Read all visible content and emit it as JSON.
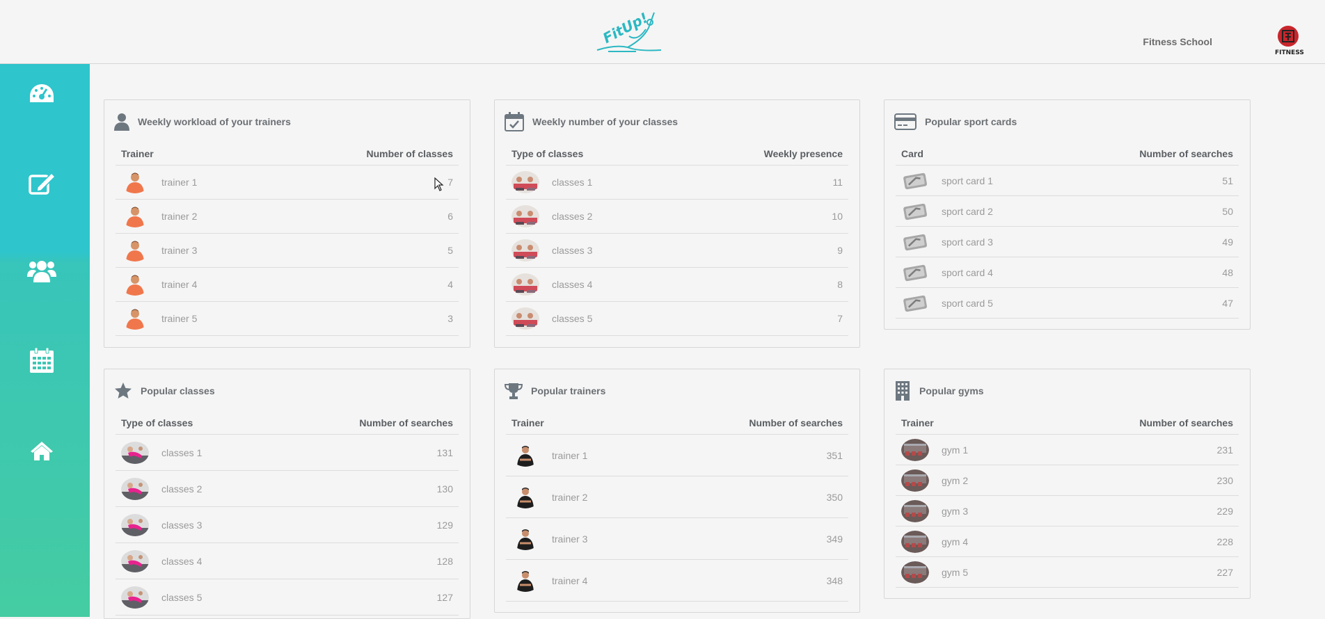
{
  "header": {
    "logo_text": "FitUp!",
    "school_name": "Fitness School",
    "school_logo_text": "FITNESS"
  },
  "sidebar": {
    "items": [
      {
        "icon": "dashboard-icon"
      },
      {
        "icon": "edit-icon"
      },
      {
        "icon": "users-icon"
      },
      {
        "icon": "calendar-icon"
      },
      {
        "icon": "home-icon"
      }
    ]
  },
  "panels": {
    "workload": {
      "title": "Weekly workload of your trainers",
      "col1": "Trainer",
      "col2": "Number of classes",
      "rows": [
        {
          "name": "trainer 1",
          "value": "7"
        },
        {
          "name": "trainer 2",
          "value": "6"
        },
        {
          "name": "trainer 3",
          "value": "5"
        },
        {
          "name": "trainer 4",
          "value": "4"
        },
        {
          "name": "trainer 5",
          "value": "3"
        }
      ]
    },
    "classes_weekly": {
      "title": "Weekly number of your classes",
      "col1": "Type of classes",
      "col2": "Weekly presence",
      "rows": [
        {
          "name": "classes 1",
          "value": "11"
        },
        {
          "name": "classes 2",
          "value": "10"
        },
        {
          "name": "classes 3",
          "value": "9"
        },
        {
          "name": "classes 4",
          "value": "8"
        },
        {
          "name": "classes 5",
          "value": "7"
        }
      ]
    },
    "sport_cards": {
      "title": "Popular sport cards",
      "col1": "Card",
      "col2": "Number of searches",
      "rows": [
        {
          "name": "sport card 1",
          "value": "51"
        },
        {
          "name": "sport card 2",
          "value": "50"
        },
        {
          "name": "sport card 3",
          "value": "49"
        },
        {
          "name": "sport card 4",
          "value": "48"
        },
        {
          "name": "sport card 5",
          "value": "47"
        }
      ]
    },
    "popular_classes": {
      "title": "Popular classes",
      "col1": "Type of classes",
      "col2": "Number of searches",
      "rows": [
        {
          "name": "classes 1",
          "value": "131"
        },
        {
          "name": "classes 2",
          "value": "130"
        },
        {
          "name": "classes 3",
          "value": "129"
        },
        {
          "name": "classes 4",
          "value": "128"
        },
        {
          "name": "classes 5",
          "value": "127"
        }
      ]
    },
    "popular_trainers": {
      "title": "Popular trainers",
      "col1": "Trainer",
      "col2": "Number of searches",
      "rows": [
        {
          "name": "trainer 1",
          "value": "351"
        },
        {
          "name": "trainer 2",
          "value": "350"
        },
        {
          "name": "trainer 3",
          "value": "349"
        },
        {
          "name": "trainer 4",
          "value": "348"
        }
      ]
    },
    "popular_gyms": {
      "title": "Popular gyms",
      "col1": "Trainer",
      "col2": "Number of searches",
      "rows": [
        {
          "name": "gym 1",
          "value": "231"
        },
        {
          "name": "gym 2",
          "value": "230"
        },
        {
          "name": "gym 3",
          "value": "229"
        },
        {
          "name": "gym 4",
          "value": "228"
        },
        {
          "name": "gym 5",
          "value": "227"
        }
      ]
    }
  },
  "colors": {
    "sidebar_top": "#2ec5cc",
    "sidebar_bottom": "#45cca2",
    "logo": "#2bb8c2",
    "title_icon": "#6d7780"
  }
}
